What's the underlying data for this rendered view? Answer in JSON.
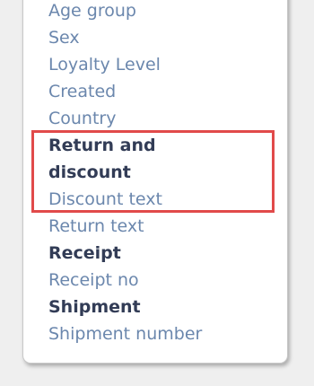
{
  "dropdown": {
    "items": [
      {
        "label": "Age group",
        "kind": "option"
      },
      {
        "label": "Sex",
        "kind": "option"
      },
      {
        "label": "Loyalty Level",
        "kind": "option"
      },
      {
        "label": "Created",
        "kind": "option"
      },
      {
        "label": "Country",
        "kind": "option"
      },
      {
        "label": "Return and",
        "kind": "group"
      },
      {
        "label": "discount",
        "kind": "group"
      },
      {
        "label": "Discount text",
        "kind": "option"
      },
      {
        "label": "Return text",
        "kind": "option"
      },
      {
        "label": "Receipt",
        "kind": "group"
      },
      {
        "label": "Receipt no",
        "kind": "option"
      },
      {
        "label": "Shipment",
        "kind": "group"
      },
      {
        "label": "Shipment number",
        "kind": "option"
      }
    ]
  },
  "colors": {
    "option_text": "#6b87ad",
    "group_text": "#323c56",
    "highlight_border": "#e14a4a",
    "panel_background": "#ffffff",
    "page_background": "#efefef"
  }
}
